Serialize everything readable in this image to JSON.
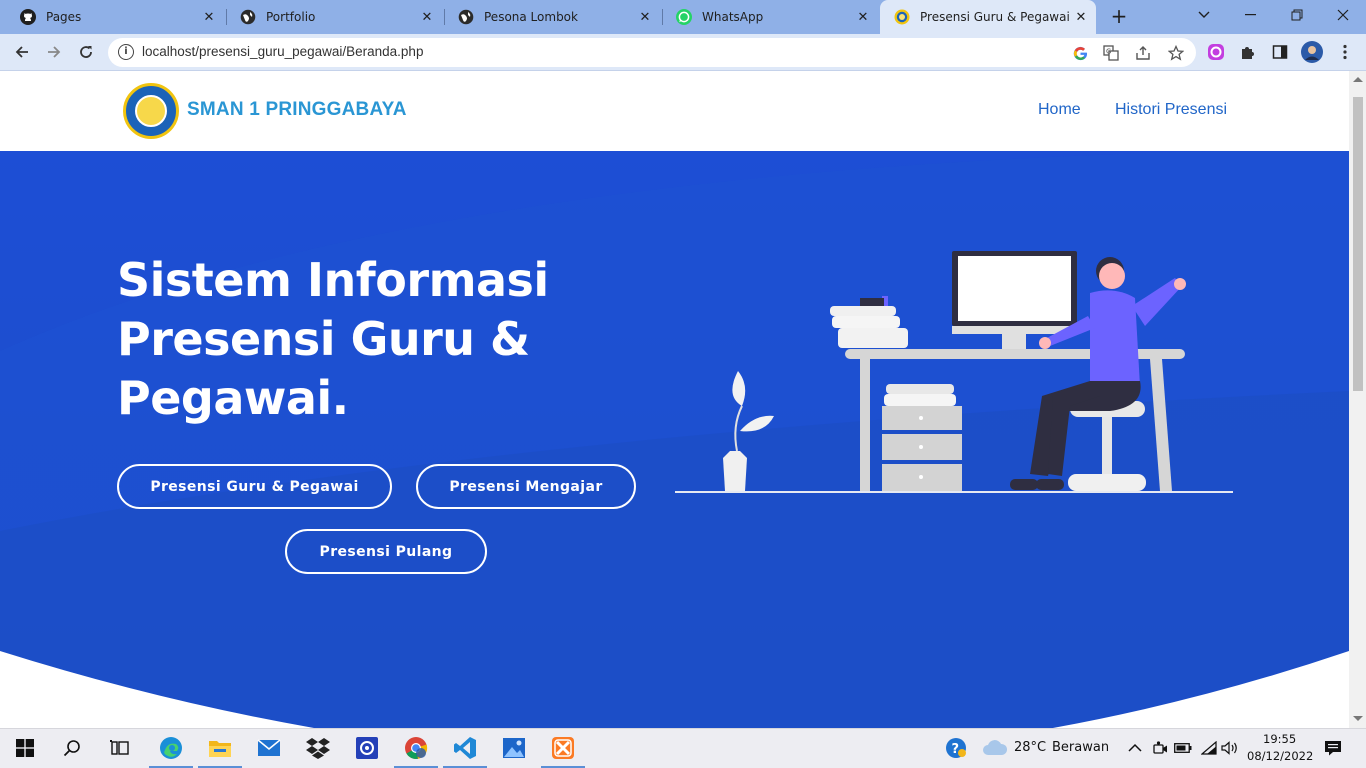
{
  "browser": {
    "tabs": [
      {
        "label": "Pages",
        "icon": "github-icon"
      },
      {
        "label": "Portfolio",
        "icon": "globe-icon"
      },
      {
        "label": "Pesona Lombok",
        "icon": "globe-icon"
      },
      {
        "label": "WhatsApp",
        "icon": "whatsapp-icon"
      },
      {
        "label": "Presensi Guru & Pegawai",
        "icon": "school-favicon",
        "active": true
      }
    ],
    "url": "localhost/presensi_guru_pegawai/Beranda.php"
  },
  "site": {
    "brand": "SMAN 1 PRINGGABAYA",
    "nav": [
      "Home",
      "Histori Presensi"
    ],
    "hero_title": "Sistem Informasi Presensi Guru & Pegawai.",
    "buttons": {
      "attendance": "Presensi Guru & Pegawai",
      "teaching": "Presensi Mengajar",
      "leave": "Presensi Pulang"
    }
  },
  "taskbar": {
    "weather_temp": "28°C",
    "weather_text": "Berawan",
    "time": "19:55",
    "date": "08/12/2022"
  },
  "colors": {
    "hero_bg": "#1d4ed5",
    "brand_text": "#2a96d4",
    "nav_link": "#2166c8",
    "illustration_accent": "#6c63ff"
  }
}
